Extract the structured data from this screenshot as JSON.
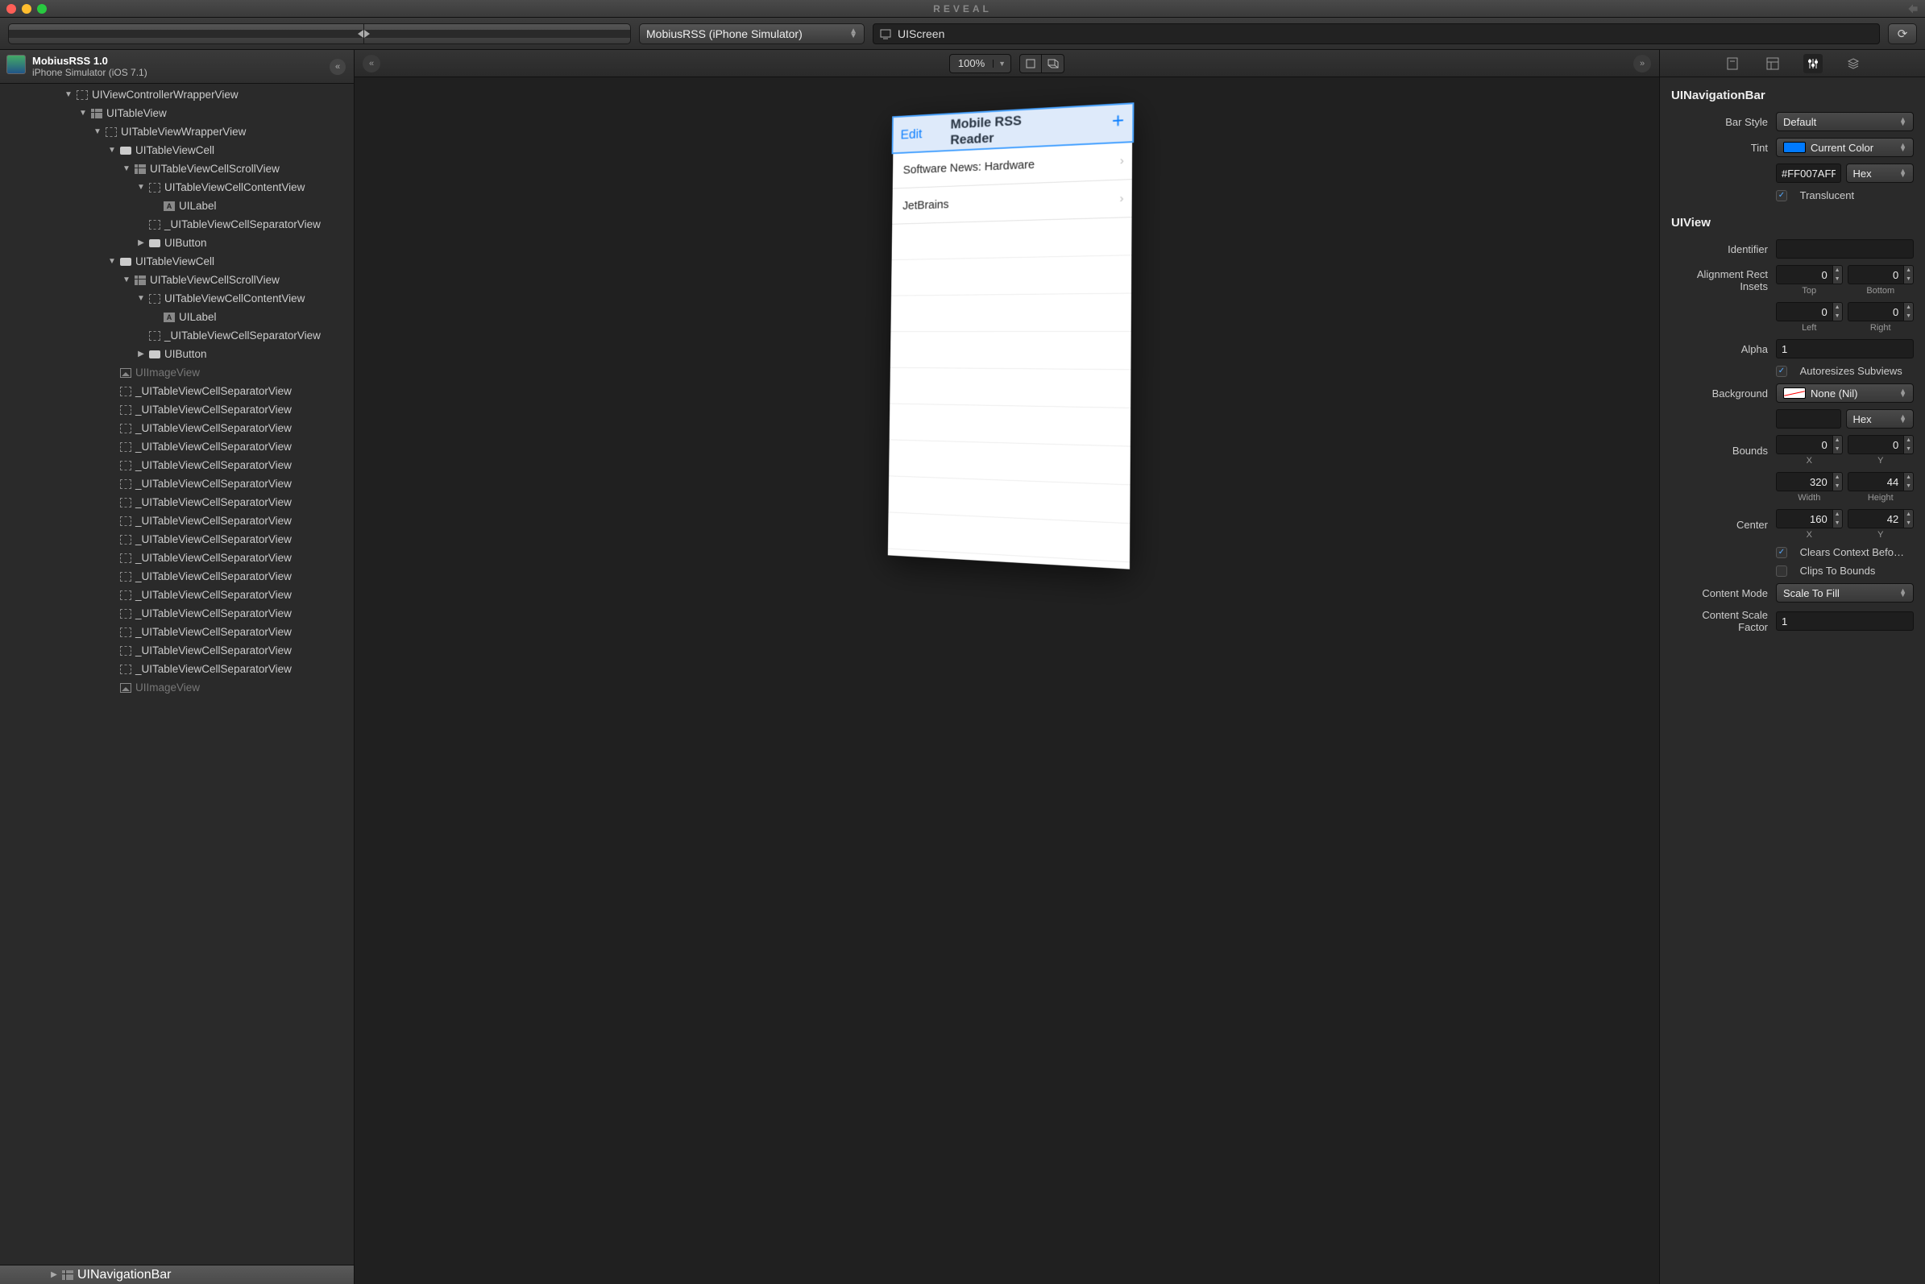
{
  "window": {
    "title": "REVEAL"
  },
  "toolbar": {
    "target": "MobiusRSS (iPhone Simulator)",
    "breadcrumb": "UIScreen"
  },
  "leftHeader": {
    "line1": "MobiusRSS 1.0",
    "line2": "iPhone Simulator (iOS 7.1)"
  },
  "tree": [
    {
      "d": 4,
      "a": "down",
      "i": "dashed",
      "t": "UIViewControllerWrapperView",
      "cut": true
    },
    {
      "d": 5,
      "a": "down",
      "i": "grid",
      "t": "UITableView"
    },
    {
      "d": 6,
      "a": "down",
      "i": "dashed",
      "t": "UITableViewWrapperView"
    },
    {
      "d": 7,
      "a": "down",
      "i": "rect",
      "t": "UITableViewCell"
    },
    {
      "d": 8,
      "a": "down",
      "i": "grid",
      "t": "UITableViewCellScrollView"
    },
    {
      "d": 9,
      "a": "down",
      "i": "dashed",
      "t": "UITableViewCellContentView"
    },
    {
      "d": 10,
      "a": "",
      "i": "a",
      "t": "UILabel"
    },
    {
      "d": 9,
      "a": "",
      "i": "dashed",
      "t": "_UITableViewCellSeparatorView"
    },
    {
      "d": 9,
      "a": "right",
      "i": "rect",
      "t": "UIButton"
    },
    {
      "d": 7,
      "a": "down",
      "i": "rect",
      "t": "UITableViewCell"
    },
    {
      "d": 8,
      "a": "down",
      "i": "grid",
      "t": "UITableViewCellScrollView"
    },
    {
      "d": 9,
      "a": "down",
      "i": "dashed",
      "t": "UITableViewCellContentView"
    },
    {
      "d": 10,
      "a": "",
      "i": "a",
      "t": "UILabel"
    },
    {
      "d": 9,
      "a": "",
      "i": "dashed",
      "t": "_UITableViewCellSeparatorView"
    },
    {
      "d": 9,
      "a": "right",
      "i": "rect",
      "t": "UIButton"
    },
    {
      "d": 7,
      "a": "",
      "i": "img",
      "t": "UIImageView",
      "muted": true
    },
    {
      "d": 7,
      "a": "",
      "i": "dashed",
      "t": "_UITableViewCellSeparatorView"
    },
    {
      "d": 7,
      "a": "",
      "i": "dashed",
      "t": "_UITableViewCellSeparatorView"
    },
    {
      "d": 7,
      "a": "",
      "i": "dashed",
      "t": "_UITableViewCellSeparatorView"
    },
    {
      "d": 7,
      "a": "",
      "i": "dashed",
      "t": "_UITableViewCellSeparatorView"
    },
    {
      "d": 7,
      "a": "",
      "i": "dashed",
      "t": "_UITableViewCellSeparatorView"
    },
    {
      "d": 7,
      "a": "",
      "i": "dashed",
      "t": "_UITableViewCellSeparatorView"
    },
    {
      "d": 7,
      "a": "",
      "i": "dashed",
      "t": "_UITableViewCellSeparatorView"
    },
    {
      "d": 7,
      "a": "",
      "i": "dashed",
      "t": "_UITableViewCellSeparatorView"
    },
    {
      "d": 7,
      "a": "",
      "i": "dashed",
      "t": "_UITableViewCellSeparatorView"
    },
    {
      "d": 7,
      "a": "",
      "i": "dashed",
      "t": "_UITableViewCellSeparatorView"
    },
    {
      "d": 7,
      "a": "",
      "i": "dashed",
      "t": "_UITableViewCellSeparatorView"
    },
    {
      "d": 7,
      "a": "",
      "i": "dashed",
      "t": "_UITableViewCellSeparatorView"
    },
    {
      "d": 7,
      "a": "",
      "i": "dashed",
      "t": "_UITableViewCellSeparatorView"
    },
    {
      "d": 7,
      "a": "",
      "i": "dashed",
      "t": "_UITableViewCellSeparatorView"
    },
    {
      "d": 7,
      "a": "",
      "i": "dashed",
      "t": "_UITableViewCellSeparatorView"
    },
    {
      "d": 7,
      "a": "",
      "i": "dashed",
      "t": "_UITableViewCellSeparatorView"
    },
    {
      "d": 7,
      "a": "",
      "i": "img",
      "t": "UIImageView",
      "muted": true
    }
  ],
  "selectedRow": {
    "d": 3,
    "a": "right",
    "i": "grid",
    "t": "UINavigationBar"
  },
  "center": {
    "zoom": "100%",
    "navEdit": "Edit",
    "navTitle": "Mobile RSS Reader",
    "navAdd": "+",
    "row1": "Software News: Hardware",
    "row2": "JetBrains"
  },
  "inspector": {
    "section1": "UINavigationBar",
    "barStyleLabel": "Bar Style",
    "barStyle": "Default",
    "tintLabel": "Tint",
    "tint": "Current Color",
    "tintHex": "#FF007AFF",
    "hexLabel": "Hex",
    "translucent": "Translucent",
    "section2": "UIView",
    "identifierLabel": "Identifier",
    "identifier": "",
    "insetsLabel": "Alignment Rect Insets",
    "top": "0",
    "topLabel": "Top",
    "bottom": "0",
    "bottomLabel": "Bottom",
    "left": "0",
    "leftLabel": "Left",
    "rightv": "0",
    "rightLabel": "Right",
    "alphaLabel": "Alpha",
    "alpha": "1",
    "autoresizes": "Autoresizes Subviews",
    "backgroundLabel": "Background",
    "background": "None (Nil)",
    "bgHex": "",
    "boundsLabel": "Bounds",
    "bx": "0",
    "bxLabel": "X",
    "by": "0",
    "byLabel": "Y",
    "bw": "320",
    "bwLabel": "Width",
    "bh": "44",
    "bhLabel": "Height",
    "centerLabel": "Center",
    "cx": "160",
    "cxLabel": "X",
    "cy": "42",
    "cyLabel": "Y",
    "clears": "Clears Context Befo…",
    "clips": "Clips To Bounds",
    "contentModeLabel": "Content Mode",
    "contentMode": "Scale To Fill",
    "scaleFactorLabel": "Content Scale Factor",
    "scaleFactor": "1"
  }
}
